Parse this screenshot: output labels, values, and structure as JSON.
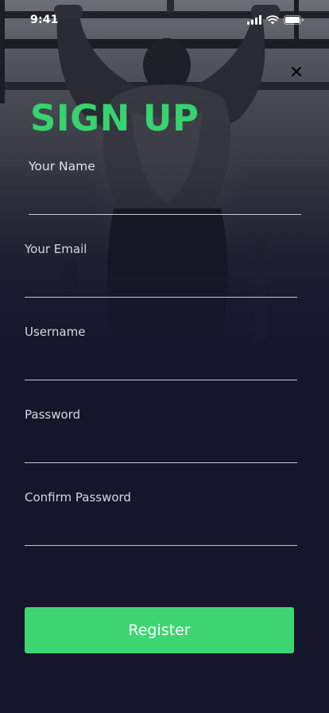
{
  "status_bar": {
    "time": "9:41",
    "icons": [
      "signal-icon",
      "wifi-icon",
      "battery-icon"
    ]
  },
  "header": {
    "close_icon": "close-icon",
    "title": "SIGN UP"
  },
  "form": {
    "fields": [
      {
        "label": "Your Name",
        "value": "",
        "placeholder": ""
      },
      {
        "label": "Your Email",
        "value": "",
        "placeholder": ""
      },
      {
        "label": "Username",
        "value": "",
        "placeholder": ""
      },
      {
        "label": "Password",
        "value": "",
        "placeholder": ""
      },
      {
        "label": "Confirm Password",
        "value": "",
        "placeholder": ""
      }
    ],
    "submit_label": "Register"
  },
  "colors": {
    "accent": "#3dd673",
    "title": "#36d36f",
    "background": "#15162b",
    "label": "#d7d7de",
    "underline": "#c8c8cf"
  }
}
